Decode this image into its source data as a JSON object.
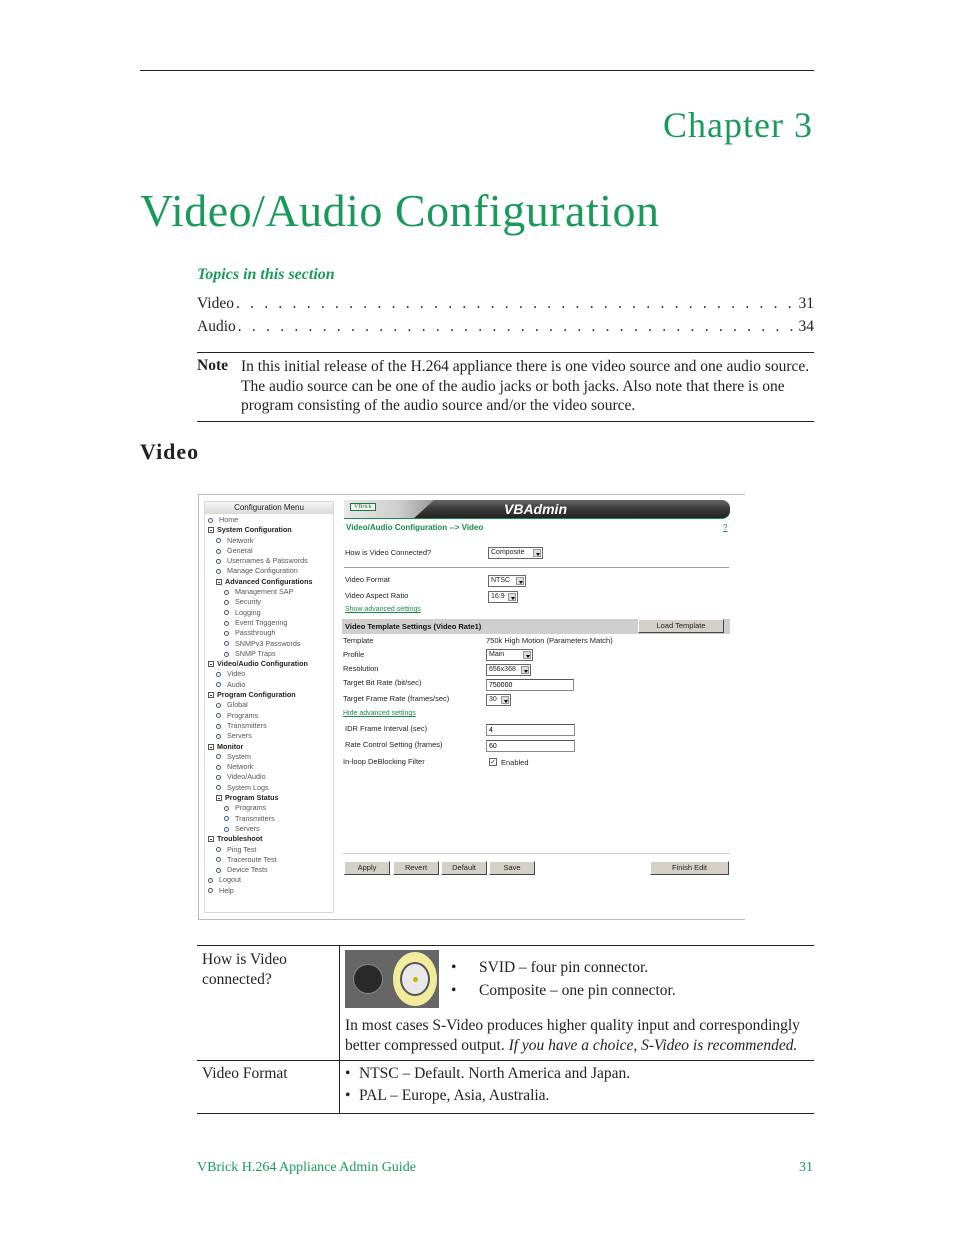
{
  "chapter_label": "Chapter 3",
  "page_title": "Video/Audio Configuration",
  "topics": {
    "heading": "Topics in this section",
    "items": [
      {
        "label": "Video",
        "page": "31"
      },
      {
        "label": "Audio",
        "page": "34"
      }
    ]
  },
  "note": {
    "label": "Note",
    "text": "In this initial release of the H.264 appliance there is one video source and one audio source. The audio source can be one of the audio jacks or both jacks. Also note that there is one program consisting of the audio source and/or the video source."
  },
  "section_heading": "Video",
  "screenshot": {
    "menu": {
      "title": "Configuration Menu",
      "items": [
        {
          "label": "Home",
          "level": "l0",
          "type": "bullet"
        },
        {
          "label": "System Configuration",
          "level": "l1b",
          "type": "group"
        },
        {
          "label": "Network",
          "level": "l1",
          "type": "bullet"
        },
        {
          "label": "General",
          "level": "l1",
          "type": "bullet"
        },
        {
          "label": "Usernames & Passwords",
          "level": "l1",
          "type": "bullet"
        },
        {
          "label": "Manage Configuration",
          "level": "l1",
          "type": "bullet"
        },
        {
          "label": "Advanced Configurations",
          "level": "l2b",
          "type": "group"
        },
        {
          "label": "Management SAP",
          "level": "l2",
          "type": "bullet"
        },
        {
          "label": "Security",
          "level": "l2",
          "type": "bullet"
        },
        {
          "label": "Logging",
          "level": "l2",
          "type": "bullet"
        },
        {
          "label": "Event Triggering",
          "level": "l2",
          "type": "bullet"
        },
        {
          "label": "Passthrough",
          "level": "l2",
          "type": "bullet"
        },
        {
          "label": "SNMPv3 Passwords",
          "level": "l2",
          "type": "bullet"
        },
        {
          "label": "SNMP Traps",
          "level": "l2",
          "type": "bullet"
        },
        {
          "label": "Video/Audio Configuration",
          "level": "l1b",
          "type": "group"
        },
        {
          "label": "Video",
          "level": "l1",
          "type": "bullet"
        },
        {
          "label": "Audio",
          "level": "l1",
          "type": "bullet"
        },
        {
          "label": "Program Configuration",
          "level": "l1b",
          "type": "group"
        },
        {
          "label": "Global",
          "level": "l1",
          "type": "bullet"
        },
        {
          "label": "Programs",
          "level": "l1",
          "type": "bullet"
        },
        {
          "label": "Transmitters",
          "level": "l1",
          "type": "bullet"
        },
        {
          "label": "Servers",
          "level": "l1",
          "type": "bullet"
        },
        {
          "label": "Monitor",
          "level": "l1b",
          "type": "group"
        },
        {
          "label": "System",
          "level": "l1",
          "type": "bullet"
        },
        {
          "label": "Network",
          "level": "l1",
          "type": "bullet"
        },
        {
          "label": "Video/Audio",
          "level": "l1",
          "type": "bullet"
        },
        {
          "label": "System Logs",
          "level": "l1",
          "type": "bullet"
        },
        {
          "label": "Program Status",
          "level": "l2b",
          "type": "group"
        },
        {
          "label": "Programs",
          "level": "l2",
          "type": "bullet"
        },
        {
          "label": "Transmitters",
          "level": "l2",
          "type": "bullet"
        },
        {
          "label": "Servers",
          "level": "l2",
          "type": "bullet"
        },
        {
          "label": "Troubleshoot",
          "level": "l1b",
          "type": "group"
        },
        {
          "label": "Ping Test",
          "level": "l1",
          "type": "bullet"
        },
        {
          "label": "Traceroute Test",
          "level": "l1",
          "type": "bullet"
        },
        {
          "label": "Device Tests",
          "level": "l1",
          "type": "bullet"
        },
        {
          "label": "Logout",
          "level": "l0",
          "type": "bullet"
        },
        {
          "label": "Help",
          "level": "l0",
          "type": "bullet"
        }
      ]
    },
    "header": {
      "logo": "VBrick",
      "title": "VBAdmin"
    },
    "breadcrumb": "Video/Audio Configuration --> Video",
    "help_link": "?",
    "video_connected": {
      "label": "How is Video Connected?",
      "value": "Composite"
    },
    "video_format": {
      "label": "Video Format",
      "value": "NTSC"
    },
    "aspect_ratio": {
      "label": "Video Aspect Ratio",
      "value": "16:9"
    },
    "show_advanced": "Show advanced settings",
    "template_section": {
      "title": "Video Template Settings (Video Rate1)",
      "load_button": "Load Template",
      "template_label": "Template",
      "template_value": "750k High Motion (Parameters Match)",
      "profile_label": "Profile",
      "profile_value": "Main",
      "resolution_label": "Resolution",
      "resolution_value": "656x368",
      "bitrate_label": "Target Bit Rate (bit/sec)",
      "bitrate_value": "750000",
      "framerate_label": "Target Frame Rate (frames/sec)",
      "framerate_value": "30",
      "hide_advanced": "Hide advanced settings",
      "idr_label": "IDR Frame Interval (sec)",
      "idr_value": "4",
      "rate_control_label": "Rate Control Setting (frames)",
      "rate_control_value": "60",
      "deblocking_label": "In-loop DeBlocking Filter",
      "deblocking_value": "Enabled",
      "deblocking_checked": true
    },
    "buttons": {
      "apply": "Apply",
      "revert": "Revert",
      "default": "Default",
      "save": "Save",
      "finish": "Finish Edit"
    }
  },
  "table": {
    "rows": [
      {
        "label": "How is Video connected?",
        "bullets": [
          "SVID – four pin connector.",
          "Composite – one pin connector."
        ],
        "text": "In most cases S-Video produces higher quality input and correspondingly better compressed output.",
        "text_italic": "If you have a choice, S-Video is recommended."
      },
      {
        "label": "Video Format",
        "bullets": [
          "NTSC – Default. North America and Japan.",
          "PAL – Europe, Asia, Australia."
        ]
      }
    ]
  },
  "footer": {
    "guide_title": "VBrick H.264 Appliance Admin Guide",
    "page_number": "31"
  }
}
